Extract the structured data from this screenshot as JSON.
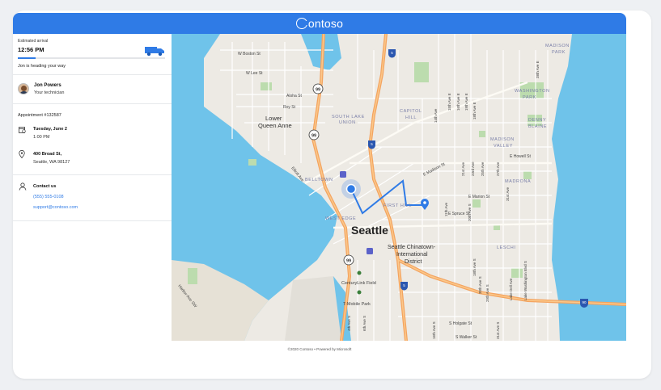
{
  "header": {
    "brand": "ontoso",
    "logo_icon": "contoso-logo-icon"
  },
  "arrival": {
    "label": "Estimated arrival",
    "time": "12:56 PM",
    "status": "Jon is heading your way",
    "progress": 0.12,
    "vehicle_icon": "delivery-van-icon"
  },
  "technician": {
    "name": "Jon Powers",
    "role": "Your technician"
  },
  "appointment": {
    "label": "Appointment #132587",
    "date": "Tuesday, June 2",
    "time": "1:00 PM",
    "address_line1": "400 Broad St,",
    "address_line2": "Seattle, WA 98127"
  },
  "contact": {
    "title": "Contact us",
    "phone": "(555) 555-0108",
    "email": "support@contoso.com"
  },
  "map": {
    "city": "Seattle",
    "labels": {
      "madison_park": "MADISON\nPARK",
      "w_boston": "W Boston St",
      "w_lee": "W Lee St",
      "aloha": "Aloha St",
      "roy": "Roy St",
      "lower_queen_anne": "Lower\nQueen Anne",
      "south_lake_union": "SOUTH LAKE\nUNION",
      "capitol_hill": "CAPITOL\nHILL",
      "washington_park": "WASHINGTON\nPARK",
      "denny_blaine": "DENNY\nBLAINE",
      "madison_valley": "MADISON\nVALLEY",
      "e_howell": "E Howell St",
      "madrona": "MADRONA",
      "e_madison": "E Madison St",
      "belltown": "BELLTOWN",
      "e_marion": "E Marion St",
      "first_hill": "FIRST HILL",
      "e_spruce": "E Spruce St",
      "west_edge": "WEST EDGE",
      "leschi": "LESCHI",
      "chinatown": "Seattle Chinatown-\nInternational\nDistrict",
      "centurylink": "CenturyLink Field",
      "tmobile": "T-Mobile Park",
      "harbor_ave": "Harbor Ave SW",
      "s_holgate": "S Holgate St",
      "s_walker": "S Walker St",
      "elliott": "Elliott Ave",
      "e_18th": "18th Ave E",
      "e_19th": "19th Ave E",
      "ave_38": "38th Ave E",
      "ave_14": "14th Ave",
      "ave_21": "21st Ave",
      "ave_23": "23rd Ave",
      "ave_25": "25th Ave",
      "ave_27": "27th Ave",
      "ave_31": "31st Ave",
      "ave_29": "29th Ave S",
      "lake_dell": "Lake Dell Ave",
      "lake_wash": "Lake Washington Blvd S",
      "ave_4": "4th Ave S",
      "ave_6": "6th Ave S",
      "ave_20s": "20th Ave S",
      "ave_30s": "30th Ave S",
      "ave_11": "11th Ave E",
      "ave_10": "10th Ave E",
      "ave_12": "12th Ave E",
      "ave_15": "15th Ave E",
      "ave_16": "16th Ave E",
      "ave_11b": "11th Ave",
      "ave_18s": "18th Ave S",
      "ave_16b": "16th Ave S",
      "ave_31s": "31st Ave S",
      "ave_35": "35th Ave E"
    },
    "shields": {
      "s99a": "99",
      "s99b": "99",
      "s99c": "99",
      "i5a": "5",
      "i5b": "5",
      "i5c": "5",
      "i90": "90"
    },
    "colors": {
      "water": "#6fc3ea",
      "land": "#edeae4",
      "park": "#bcdcae",
      "highway": "#f4a460",
      "route": "#2f7be6"
    }
  },
  "footer": {
    "text": "©2020 Contoso • Powered by Microsoft"
  }
}
